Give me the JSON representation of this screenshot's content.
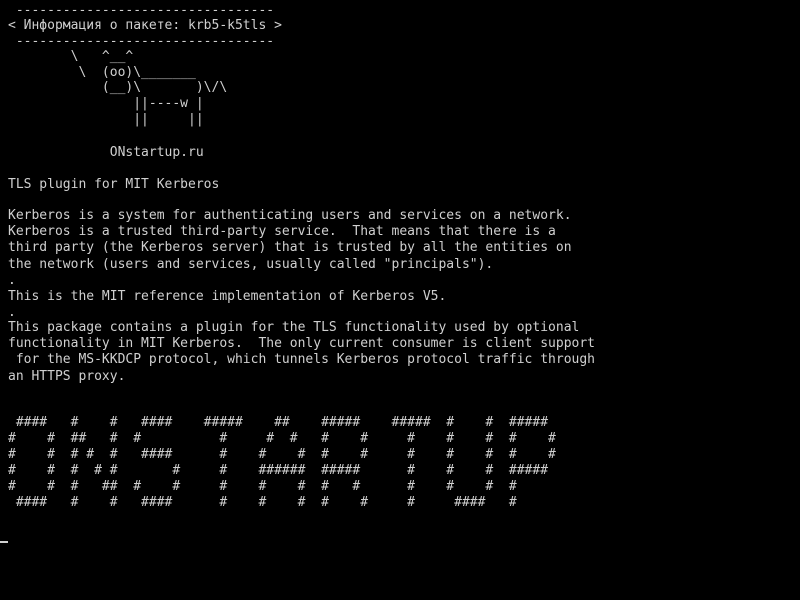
{
  "screen": {
    "fg_color": "#d0d0d0",
    "bg_color": "#000000"
  },
  "banner": [
    " ---------------------------------",
    "< Информация о пакете: krb5-k5tls >",
    " ---------------------------------",
    "        \\   ^__^",
    "         \\  (oo)\\_______",
    "            (__)\\       )\\/\\",
    "                ||----w |",
    "                ||     ||"
  ],
  "site_line": "             ONstartup.ru",
  "description": [
    "TLS plugin for MIT Kerberos",
    "Kerberos is a system for authenticating users and services on a network.",
    "Kerberos is a trusted third-party service.  That means that there is a",
    "third party (the Kerberos server) that is trusted by all the entities on",
    "the network (users and services, usually called \"principals\").",
    ".",
    "This is the MIT reference implementation of Kerberos V5.",
    ".",
    "This package contains a plugin for the TLS functionality used by optional",
    "functionality in MIT Kerberos.  The only current consumer is client support",
    " for the MS-KKDCP protocol, which tunnels Kerberos protocol traffic through",
    "an HTTPS proxy."
  ],
  "ascii_art": [
    " ####   #    #   ####    #####    ##    #####    #####  #    #  #####",
    "#    #  ##   #  #          #     #  #   #    #     #    #    #  #    #",
    "#    #  # #  #   ####      #    #    #  #    #     #    #    #  #    #",
    "#    #  #  # #       #     #    ######  #####      #    #    #  #####",
    "#    #  #   ##  #    #     #    #    #  #   #      #    #    #  #",
    " ####   #    #   ####      #    #    #  #    #     #     ####   #"
  ]
}
